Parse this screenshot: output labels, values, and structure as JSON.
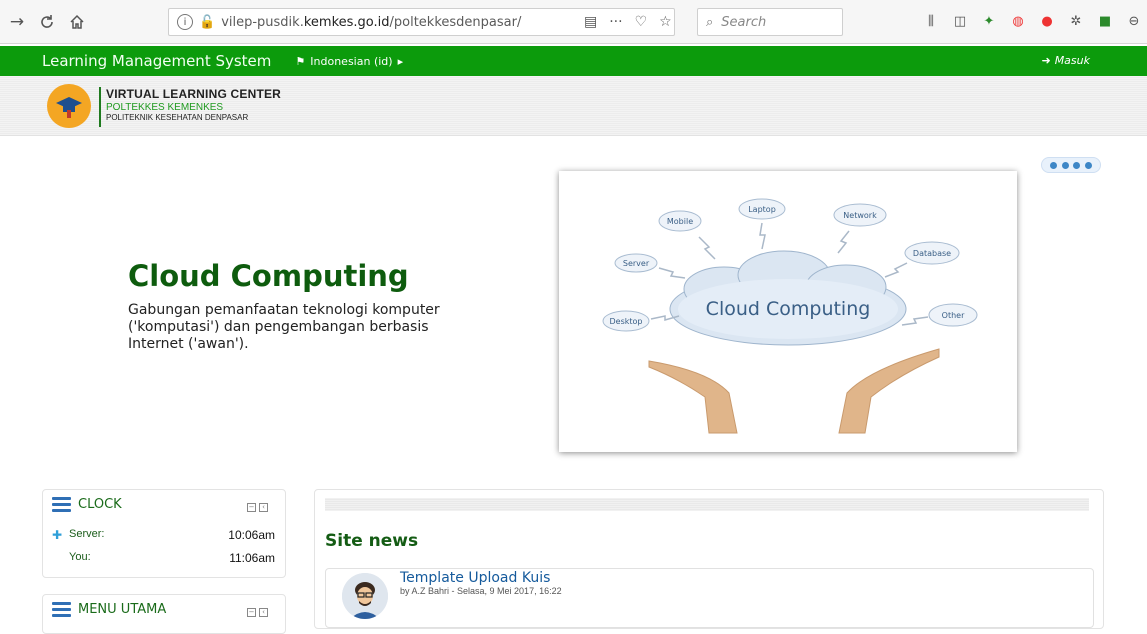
{
  "browser": {
    "url_prefix": "vilep-pusdik.",
    "url_host": "kemkes.go.id",
    "url_path": "/poltekkesdenpasar/",
    "search_placeholder": "Search",
    "info_icon": "i"
  },
  "navbar": {
    "brand": "Learning Management System",
    "language": "Indonesian (id)",
    "login": "Masuk",
    "color": "#0c9b0c"
  },
  "header": {
    "title": "VIRTUAL LEARNING CENTER",
    "subtitle": "POLTEKKES KEMENKES",
    "institution": "POLITEKNIK KESEHATAN DENPASAR"
  },
  "slider": {
    "title": "Cloud Computing",
    "description": "Gabungan pemanfaatan teknologi komputer ('komputasi') dan pengembangan berbasis Internet ('awan').",
    "image_cloud_label": "Cloud Computing",
    "image_labels": {
      "mobile": "Mobile",
      "laptop": "Laptop",
      "network": "Network",
      "server": "Server",
      "database": "Database",
      "desktop": "Desktop",
      "other": "Other"
    }
  },
  "clock_block": {
    "title": "CLOCK",
    "server_label": "Server:",
    "server_time": "10:06am",
    "you_label": "You:",
    "you_time": "11:06am"
  },
  "menu_block": {
    "title": "MENU UTAMA"
  },
  "site_news": {
    "title": "Site news",
    "posts": [
      {
        "title": "Template Upload Kuis",
        "meta": "by A.Z Bahri - Selasa, 9 Mei 2017, 16:22"
      }
    ]
  }
}
